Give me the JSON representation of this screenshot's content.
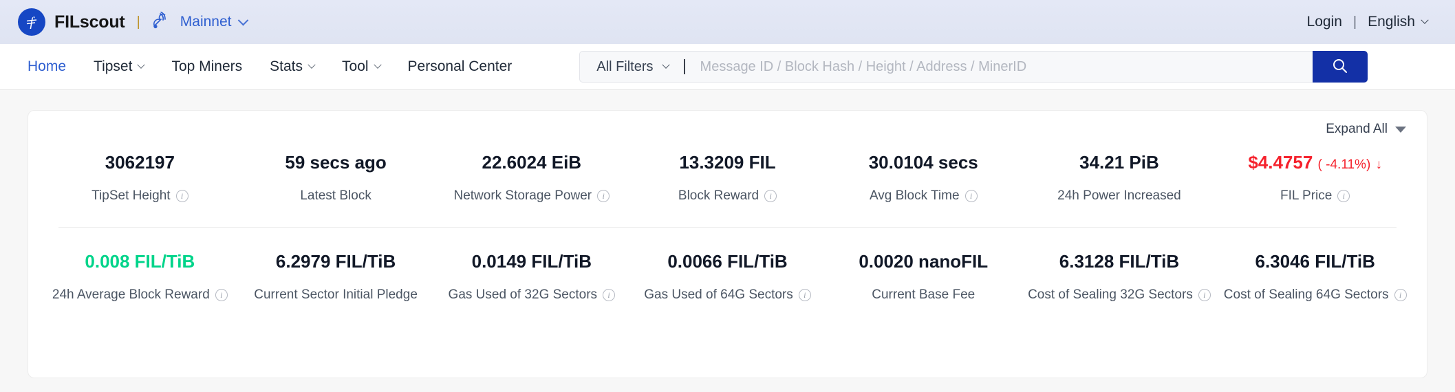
{
  "topbar": {
    "brand_name": "FILscout",
    "separator": "|",
    "network_label": "Mainnet",
    "login_label": "Login",
    "language_label": "English"
  },
  "nav": {
    "items": [
      {
        "label": "Home",
        "has_chevron": false,
        "active": true
      },
      {
        "label": "Tipset",
        "has_chevron": true,
        "active": false
      },
      {
        "label": "Top Miners",
        "has_chevron": false,
        "active": false
      },
      {
        "label": "Stats",
        "has_chevron": true,
        "active": false
      },
      {
        "label": "Tool",
        "has_chevron": true,
        "active": false
      },
      {
        "label": "Personal Center",
        "has_chevron": false,
        "active": false
      }
    ]
  },
  "search": {
    "filters_label": "All Filters",
    "placeholder": "Message ID / Block Hash / Height / Address / MinerID",
    "value": ""
  },
  "stats_panel": {
    "expand_all_label": "Expand All",
    "row1": [
      {
        "value": "3062197",
        "label": "TipSet Height",
        "info": true,
        "color": "default"
      },
      {
        "value": "59 secs ago",
        "label": "Latest Block",
        "info": false,
        "color": "default"
      },
      {
        "value": "22.6024 EiB",
        "label": "Network Storage Power",
        "info": true,
        "color": "default"
      },
      {
        "value": "13.3209 FIL",
        "label": "Block Reward",
        "info": true,
        "color": "default"
      },
      {
        "value": "30.0104 secs",
        "label": "Avg Block Time",
        "info": true,
        "color": "default"
      },
      {
        "value": "34.21 PiB",
        "label": "24h Power Increased",
        "info": false,
        "color": "default"
      },
      {
        "value": "$4.4757",
        "label": "FIL Price",
        "info": true,
        "color": "red",
        "change": "( -4.11%)",
        "change_arrow": "↓"
      }
    ],
    "row2": [
      {
        "value": "0.008 FIL/TiB",
        "label": "24h Average Block Reward",
        "info": true,
        "color": "green"
      },
      {
        "value": "6.2979 FIL/TiB",
        "label": "Current Sector Initial Pledge",
        "info": false,
        "color": "default"
      },
      {
        "value": "0.0149 FIL/TiB",
        "label": "Gas Used of 32G Sectors",
        "info": true,
        "color": "default"
      },
      {
        "value": "0.0066 FIL/TiB",
        "label": "Gas Used of 64G Sectors",
        "info": true,
        "color": "default"
      },
      {
        "value": "0.0020 nanoFIL",
        "label": "Current Base Fee",
        "info": false,
        "color": "default"
      },
      {
        "value": "6.3128 FIL/TiB",
        "label": "Cost of Sealing 32G Sectors",
        "info": true,
        "color": "default"
      },
      {
        "value": "6.3046 FIL/TiB",
        "label": "Cost of Sealing 64G Sectors",
        "info": true,
        "color": "default"
      }
    ]
  },
  "colors": {
    "brand_blue": "#1647c4",
    "link_blue": "#2f5fd0",
    "search_button": "#1330a6",
    "positive_green": "#00d48a",
    "negative_red": "#f5222d"
  },
  "icons": {
    "logo": "filecoin-logo-icon",
    "network": "satellite-dish-icon",
    "search": "search-icon",
    "info": "info-icon",
    "chevron": "chevron-down-icon",
    "caret": "caret-down-icon"
  }
}
